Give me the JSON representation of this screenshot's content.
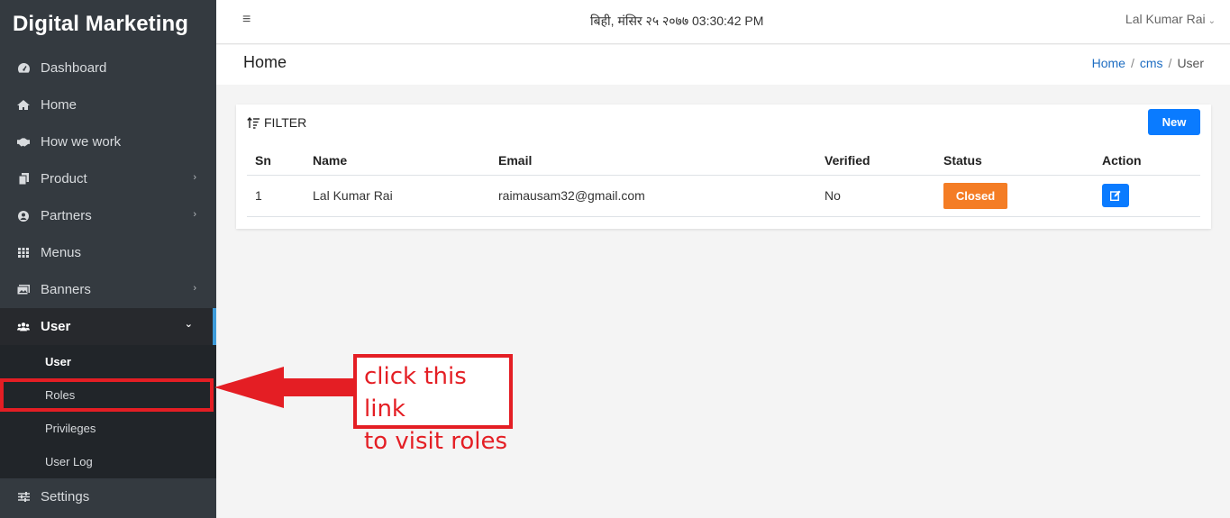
{
  "app": {
    "brand": "Digital Marketing"
  },
  "sidebar": {
    "items": [
      {
        "label": "Dashboard",
        "icon": "dashboard-icon"
      },
      {
        "label": "Home",
        "icon": "home-icon"
      },
      {
        "label": "How we work",
        "icon": "handshake-icon"
      },
      {
        "label": "Product",
        "icon": "copy-icon"
      },
      {
        "label": "Partners",
        "icon": "user-circle-icon"
      },
      {
        "label": "Menus",
        "icon": "grid-icon"
      },
      {
        "label": "Banners",
        "icon": "images-icon"
      },
      {
        "label": "User",
        "icon": "users-icon"
      }
    ],
    "user_submenu": [
      "User",
      "Roles",
      "Privileges",
      "User Log"
    ],
    "settings_label": "Settings"
  },
  "topbar": {
    "datetime": "बिही, मंसिर २५ २०७७ 03:30:42 PM",
    "username": "Lal Kumar Rai"
  },
  "page": {
    "title": "Home",
    "breadcrumb": [
      "Home",
      "cms",
      "User"
    ]
  },
  "card": {
    "filter_label": "FILTER",
    "new_button": "New",
    "columns": [
      "Sn",
      "Name",
      "Email",
      "Verified",
      "Status",
      "Action"
    ],
    "rows": [
      {
        "sn": "1",
        "name": "Lal Kumar Rai",
        "email": "raimausam32@gmail.com",
        "verified": "No",
        "status": "Closed"
      }
    ]
  },
  "annotation": {
    "line1": "click this link",
    "line2": "to visit roles"
  },
  "colors": {
    "sidebar_bg": "#343a40",
    "primary": "#0a7bff",
    "status_closed": "#f47d25",
    "annotation": "#e41e24"
  }
}
